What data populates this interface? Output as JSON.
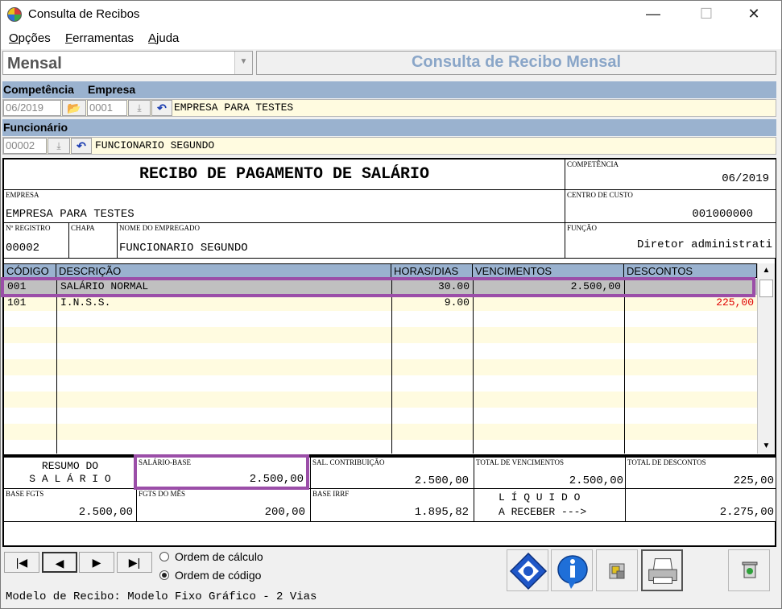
{
  "window": {
    "title": "Consulta de Recibos",
    "minimize": "—",
    "maximize": "☐",
    "close": "✕"
  },
  "menu": [
    {
      "label": "Opções",
      "hot": "O",
      "rest": "pções"
    },
    {
      "label": "Ferramentas",
      "hot": "F",
      "rest": "erramentas"
    },
    {
      "label": "Ajuda",
      "hot": "A",
      "rest": "juda"
    }
  ],
  "mode": {
    "value": "Mensal"
  },
  "header": {
    "title": "Consulta de Recibo Mensal"
  },
  "filters": {
    "competencia_label": "Competência",
    "empresa_label": "Empresa",
    "competencia_value": "06/2019",
    "empresa_code": "0001",
    "empresa_name": "EMPRESA PARA TESTES",
    "funcionario_label": "Funcionário",
    "funcionario_code": "00002",
    "funcionario_name": "FUNCIONARIO SEGUNDO"
  },
  "receipt": {
    "title": "RECIBO DE PAGAMENTO DE SALÁRIO",
    "competencia_label": "COMPETÊNCIA",
    "competencia_value": "06/2019",
    "empresa_label": "EMPRESA",
    "empresa_value": "EMPRESA PARA TESTES",
    "centro_label": "CENTRO DE CUSTO",
    "centro_value": "001000000",
    "registro_label": "Nº REGISTRO",
    "registro_value": "00002",
    "chapa_label": "CHAPA",
    "nome_label": "NOME DO EMPREGADO",
    "nome_value": "FUNCIONARIO SEGUNDO",
    "funcao_label": "FUNÇÃO",
    "funcao_value": "Diretor administrati"
  },
  "grid": {
    "columns": [
      "CÓDIGO",
      "DESCRIÇÃO",
      "HORAS/DIAS",
      "VENCIMENTOS",
      "DESCONTOS"
    ],
    "rows": [
      {
        "codigo": "001",
        "descricao": "SALÁRIO NORMAL",
        "horas": "30.00",
        "vencimentos": "2.500,00",
        "descontos": ""
      },
      {
        "codigo": "101",
        "descricao": "I.N.S.S.",
        "horas": "9.00",
        "vencimentos": "",
        "descontos": "225,00"
      }
    ],
    "scroll_up": "▲",
    "scroll_down": "▼"
  },
  "summary": {
    "resumo_line1": "RESUMO DO",
    "resumo_line2": "S A L Á R I O",
    "salario_base_label": "SALÁRIO-BASE",
    "salario_base_value": "2.500,00",
    "sal_contrib_label": "SAL. CONTRIBUIÇÃO",
    "sal_contrib_value": "2.500,00",
    "total_venc_label": "TOTAL DE VENCIMENTOS",
    "total_venc_value": "2.500,00",
    "total_desc_label": "TOTAL DE DESCONTOS",
    "total_desc_value": "225,00",
    "base_fgts_label": "BASE FGTS",
    "base_fgts_value": "2.500,00",
    "fgts_mes_label": "FGTS DO MÊS",
    "fgts_mes_value": "200,00",
    "base_irrf_label": "BASE IRRF",
    "base_irrf_value": "1.895,82",
    "liquido_line1": "L Í Q U I D O",
    "liquido_line2": "A RECEBER --->",
    "liquido_value": "2.275,00"
  },
  "nav": {
    "first": "|◀",
    "prev": "◀",
    "next": "▶",
    "last": "▶|"
  },
  "order": {
    "calc_label": "Ordem de cálculo",
    "code_label": "Ordem de código",
    "selected": "code"
  },
  "footer": {
    "text": "Modelo de Recibo: Modelo Fixo Gráfico - 2 Vias"
  },
  "colors": {
    "band": "#9ab2cf",
    "highlight": "#9b4ea8",
    "negative": "#e00000",
    "rowAlt": "#fffbe0"
  }
}
